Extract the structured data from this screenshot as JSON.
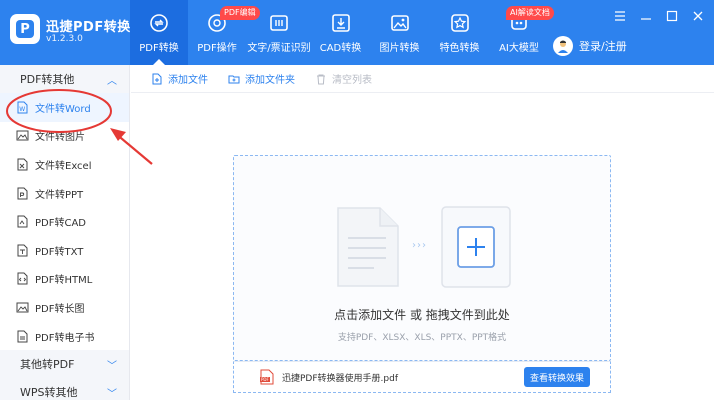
{
  "app": {
    "title": "迅捷PDF转换器",
    "version": "v1.2.3.0",
    "logo_letter": "P",
    "accent": "#2d82ee"
  },
  "nav": [
    {
      "label": "PDF转换",
      "icon": "pdf-convert-icon",
      "active": true
    },
    {
      "label": "PDF操作",
      "icon": "pdf-operate-icon",
      "badge": "PDF编辑"
    },
    {
      "label": "文字/票证识别",
      "icon": "ocr-icon"
    },
    {
      "label": "CAD转换",
      "icon": "cad-icon"
    },
    {
      "label": "图片转换",
      "icon": "image-icon"
    },
    {
      "label": "特色转换",
      "icon": "star-icon"
    },
    {
      "label": "AI大模型",
      "icon": "ai-icon",
      "badge": "AI解读文档"
    }
  ],
  "login": {
    "label": "登录/注册"
  },
  "sidebar": {
    "group_pdf": "PDF转其他",
    "items": [
      {
        "label": "文件转Word",
        "icon": "word-file-icon",
        "active": true
      },
      {
        "label": "文件转图片",
        "icon": "image-file-icon"
      },
      {
        "label": "文件转Excel",
        "icon": "excel-file-icon"
      },
      {
        "label": "文件转PPT",
        "icon": "ppt-file-icon"
      },
      {
        "label": "PDF转CAD",
        "icon": "cad-file-icon"
      },
      {
        "label": "PDF转TXT",
        "icon": "txt-file-icon"
      },
      {
        "label": "PDF转HTML",
        "icon": "html-file-icon"
      },
      {
        "label": "PDF转长图",
        "icon": "long-image-icon"
      },
      {
        "label": "PDF转电子书",
        "icon": "ebook-icon"
      }
    ],
    "group_other": "其他转PDF",
    "group_wps": "WPS转其他"
  },
  "toolbar": {
    "add_file": "添加文件",
    "add_folder": "添加文件夹",
    "clear_list": "清空列表"
  },
  "dropzone": {
    "main_text": "点击添加文件 或 拖拽文件到此处",
    "sub_text": "支持PDF、XLSX、XLS、PPTX、PPT格式",
    "arrows": "›››"
  },
  "file_bar": {
    "file_name": "迅捷PDF转换器使用手册.pdf",
    "effect_button": "查看转换效果"
  },
  "colors": {
    "header": "#2d82ee",
    "badge": "#ff4a4a",
    "annotation": "#e53935"
  }
}
